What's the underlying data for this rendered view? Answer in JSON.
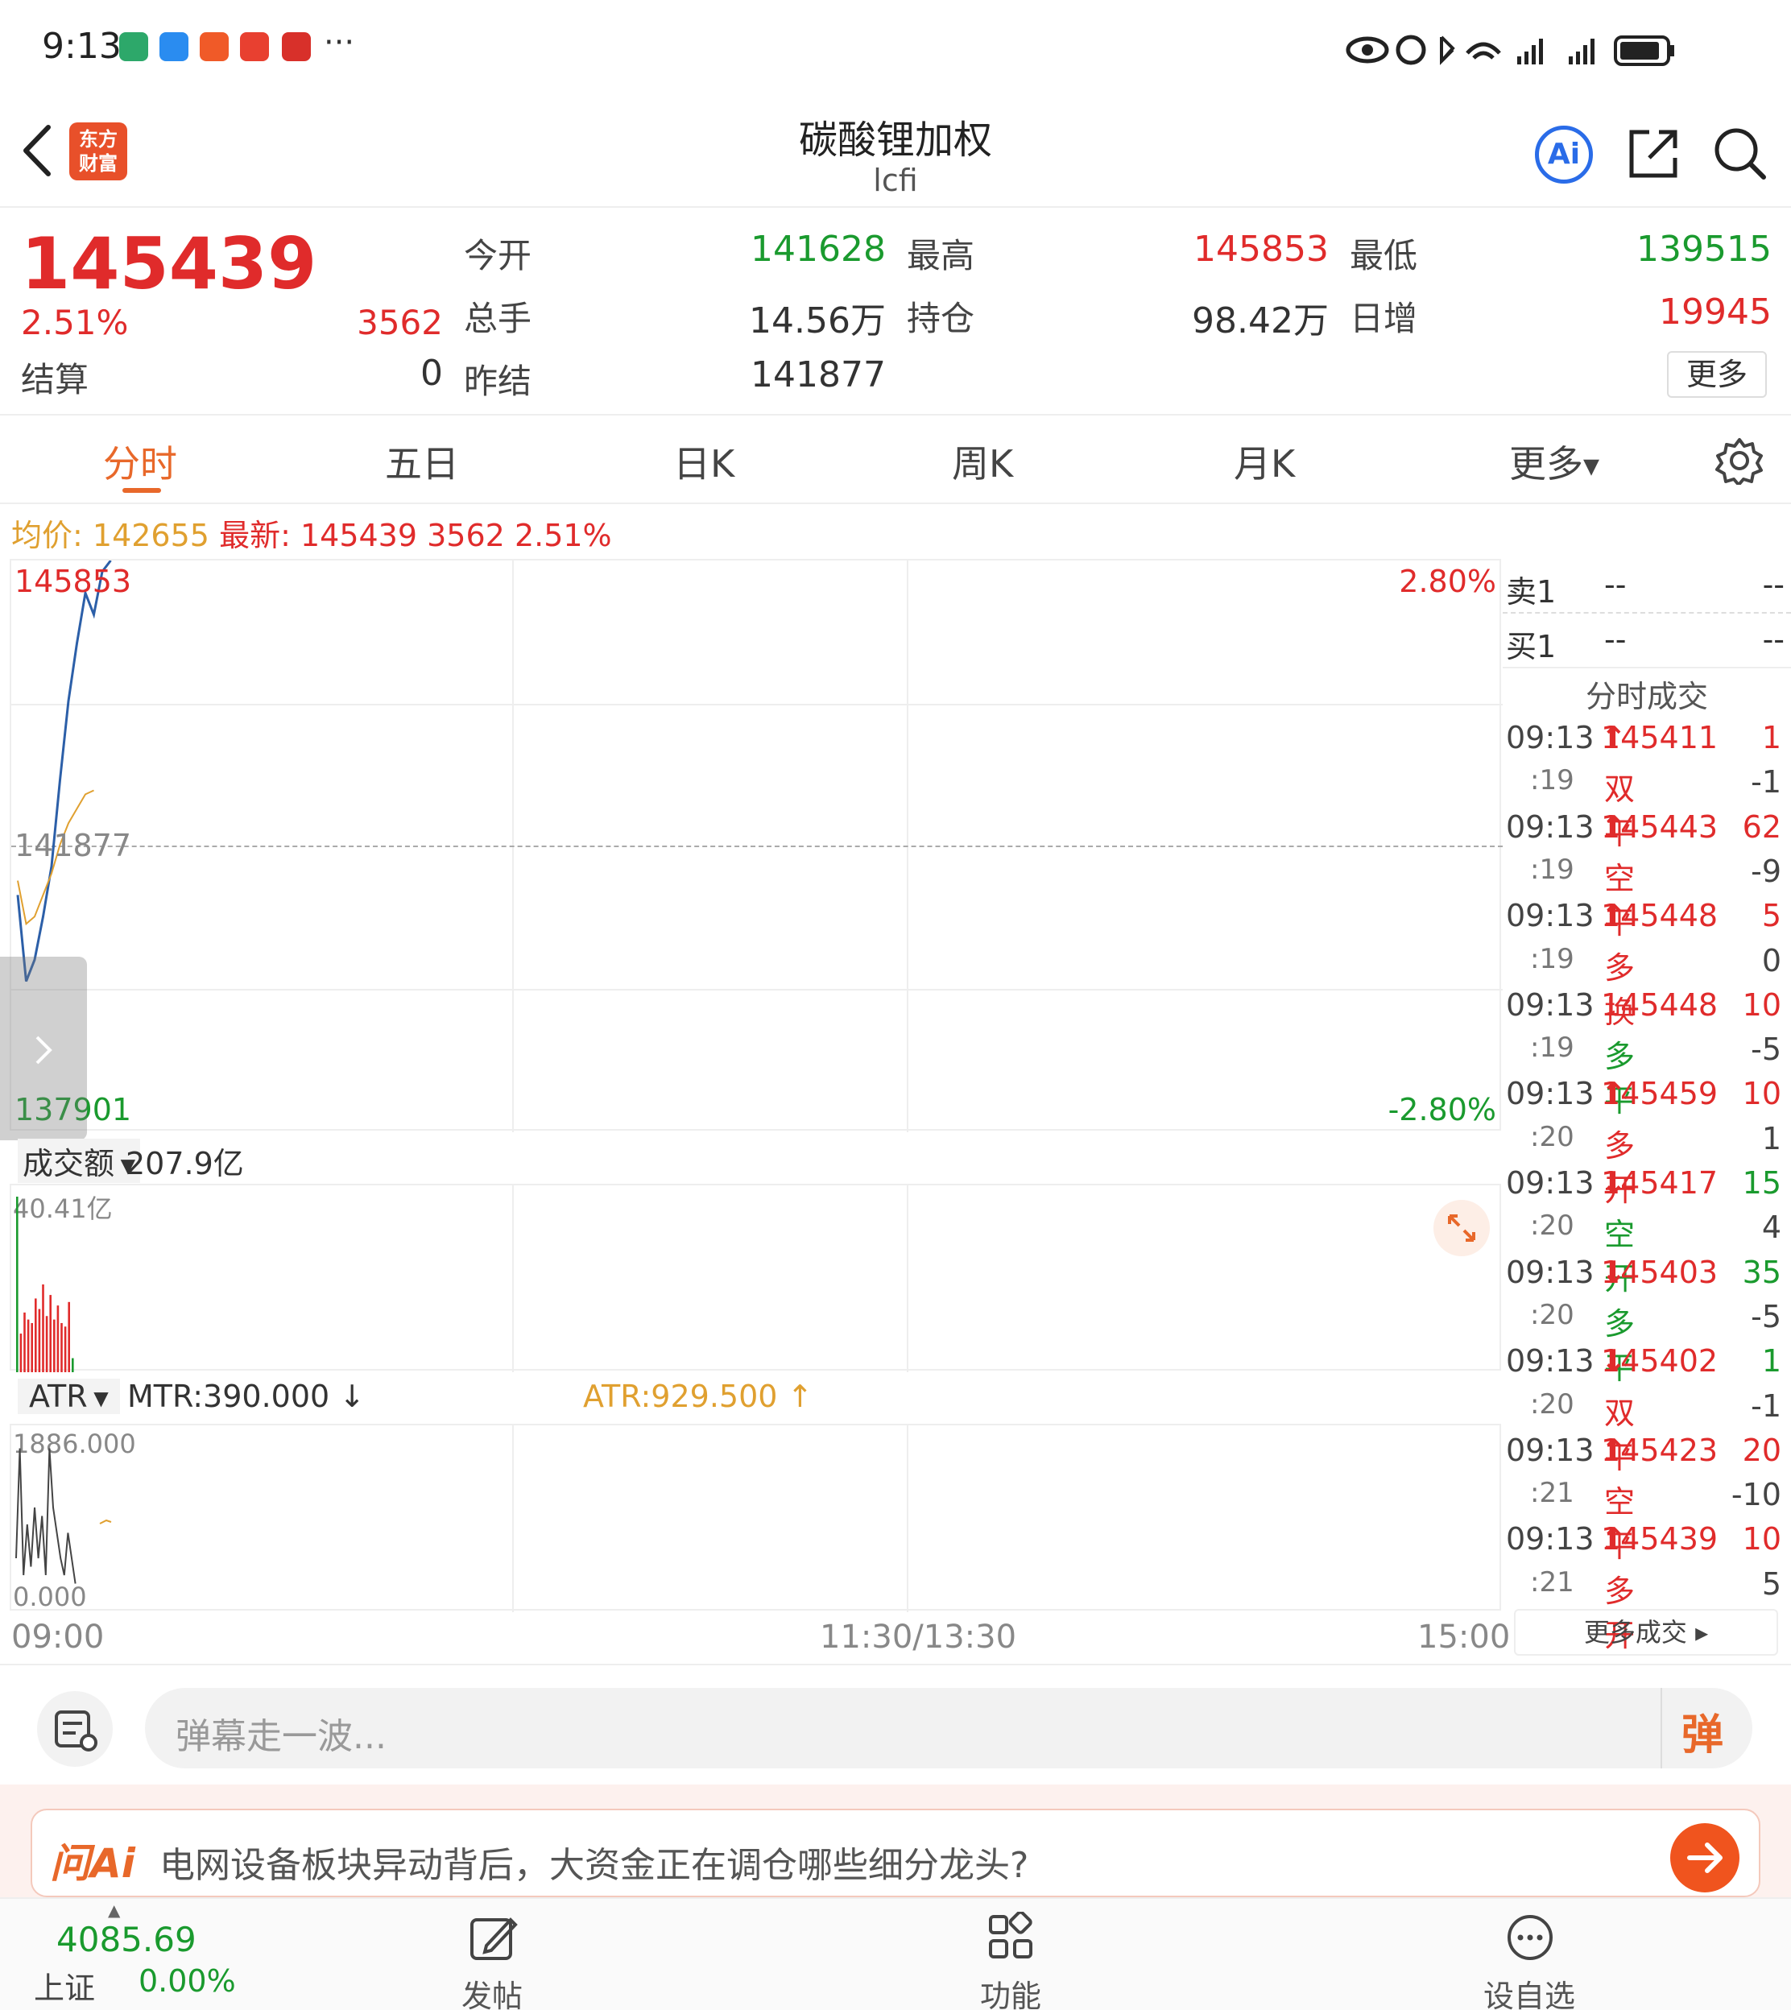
{
  "status": {
    "time": "9:13",
    "more": "···"
  },
  "header": {
    "title": "碳酸锂加权",
    "code": "lcfi",
    "logo_line1": "东方",
    "logo_line2": "财富",
    "ai_label": "Ai"
  },
  "quote": {
    "price": "145439",
    "change_pct": "2.51%",
    "change": "3562",
    "settle_label": "结算",
    "settle": "0",
    "open_label": "今开",
    "open": "141628",
    "high_label": "最高",
    "high": "145853",
    "low_label": "最低",
    "low": "139515",
    "vol_label": "总手",
    "vol": "14.56万",
    "oi_label": "持仓",
    "oi": "98.42万",
    "daily_label": "日增",
    "daily": "19945",
    "prev_label": "昨结",
    "prev": "141877",
    "more": "更多"
  },
  "tabs": [
    "分时",
    "五日",
    "日K",
    "周K",
    "月K",
    "更多"
  ],
  "info_line": {
    "avg_label": "均价:",
    "avg": "142655",
    "last_label": "最新:",
    "last": "145439",
    "chg": "3562",
    "pct": "2.51%"
  },
  "chart": {
    "y_top": "145853",
    "y_mid": "141877",
    "y_bottom": "137901",
    "pct_top": "2.80%",
    "pct_bottom": "-2.80%",
    "turnover_label": "成交额",
    "turnover": "207.9亿",
    "turnover_max": "40.41亿",
    "atr_label": "ATR",
    "mtr": "MTR:390.000",
    "atr": "ATR:929.500",
    "atr_max": "1886.000",
    "atr_min": "0.000",
    "x_start": "09:00",
    "x_mid": "11:30/13:30",
    "x_end": "15:00"
  },
  "chart_data": {
    "type": "line",
    "ylim": [
      137901,
      145853
    ],
    "series": [
      {
        "name": "最新",
        "color": "#2c5fa8",
        "values": [
          141200,
          140000,
          140300,
          140900,
          141600,
          142800,
          143900,
          144700,
          145400,
          145100,
          145700,
          145853
        ]
      },
      {
        "name": "均价",
        "color": "#e0a030",
        "values": [
          141400,
          140800,
          140900,
          141200,
          141500,
          141900,
          142200,
          142400,
          142600,
          142655
        ]
      }
    ]
  },
  "orderbook": {
    "sell1": "卖1",
    "buy1": "买1",
    "dash": "--"
  },
  "trades_title": "分时成交",
  "trades": [
    {
      "t": "09:13",
      "p": "145411",
      "arrow": "↑",
      "v": "1",
      "pc": "red",
      "vc": "red"
    },
    {
      "t": ":19",
      "p": "双平",
      "arrow": "",
      "v": "-1",
      "pc": "red",
      "vc": "gray"
    },
    {
      "t": "09:13",
      "p": "145443",
      "arrow": "↑",
      "v": "62",
      "pc": "red",
      "vc": "red"
    },
    {
      "t": ":19",
      "p": "空平",
      "arrow": "",
      "v": "-9",
      "pc": "red",
      "vc": "gray"
    },
    {
      "t": "09:13",
      "p": "145448",
      "arrow": "↑",
      "v": "5",
      "pc": "red",
      "vc": "red"
    },
    {
      "t": ":19",
      "p": "多换",
      "arrow": "",
      "v": "0",
      "pc": "red",
      "vc": "gray"
    },
    {
      "t": "09:13",
      "p": "145448",
      "arrow": "",
      "v": "10",
      "pc": "red",
      "vc": "red"
    },
    {
      "t": ":19",
      "p": "多平",
      "arrow": "",
      "v": "-5",
      "pc": "green",
      "vc": "gray"
    },
    {
      "t": "09:13",
      "p": "145459",
      "arrow": "↑",
      "v": "10",
      "pc": "red",
      "vc": "red"
    },
    {
      "t": ":20",
      "p": "多开",
      "arrow": "",
      "v": "1",
      "pc": "red",
      "vc": "gray"
    },
    {
      "t": "09:13",
      "p": "145417",
      "arrow": "↓",
      "v": "15",
      "pc": "red",
      "vc": "green"
    },
    {
      "t": ":20",
      "p": "空开",
      "arrow": "",
      "v": "4",
      "pc": "green",
      "vc": "gray"
    },
    {
      "t": "09:13",
      "p": "145403",
      "arrow": "↓",
      "v": "35",
      "pc": "red",
      "vc": "green"
    },
    {
      "t": ":20",
      "p": "多平",
      "arrow": "",
      "v": "-5",
      "pc": "green",
      "vc": "gray"
    },
    {
      "t": "09:13",
      "p": "145402",
      "arrow": "↓",
      "v": "1",
      "pc": "red",
      "vc": "green"
    },
    {
      "t": ":20",
      "p": "双平",
      "arrow": "",
      "v": "-1",
      "pc": "red",
      "vc": "gray"
    },
    {
      "t": "09:13",
      "p": "145423",
      "arrow": "↑",
      "v": "20",
      "pc": "red",
      "vc": "red"
    },
    {
      "t": ":21",
      "p": "空平",
      "arrow": "",
      "v": "-10",
      "pc": "red",
      "vc": "gray"
    },
    {
      "t": "09:13",
      "p": "145439",
      "arrow": "↑",
      "v": "10",
      "pc": "red",
      "vc": "red"
    },
    {
      "t": ":21",
      "p": "多开",
      "arrow": "",
      "v": "5",
      "pc": "red",
      "vc": "gray"
    }
  ],
  "more_trades": "更多成交",
  "danmu": {
    "placeholder": "弹幕走一波...",
    "btn": "弹"
  },
  "ai_bar": {
    "logo": "问Ai",
    "text": "电网设备板块异动背后，大资金正在调仓哪些细分龙头?"
  },
  "bottom": {
    "index_value": "4085.69",
    "index_name": "上证",
    "index_pct": "0.00%",
    "post": "发帖",
    "func": "功能",
    "watch": "设自选"
  }
}
